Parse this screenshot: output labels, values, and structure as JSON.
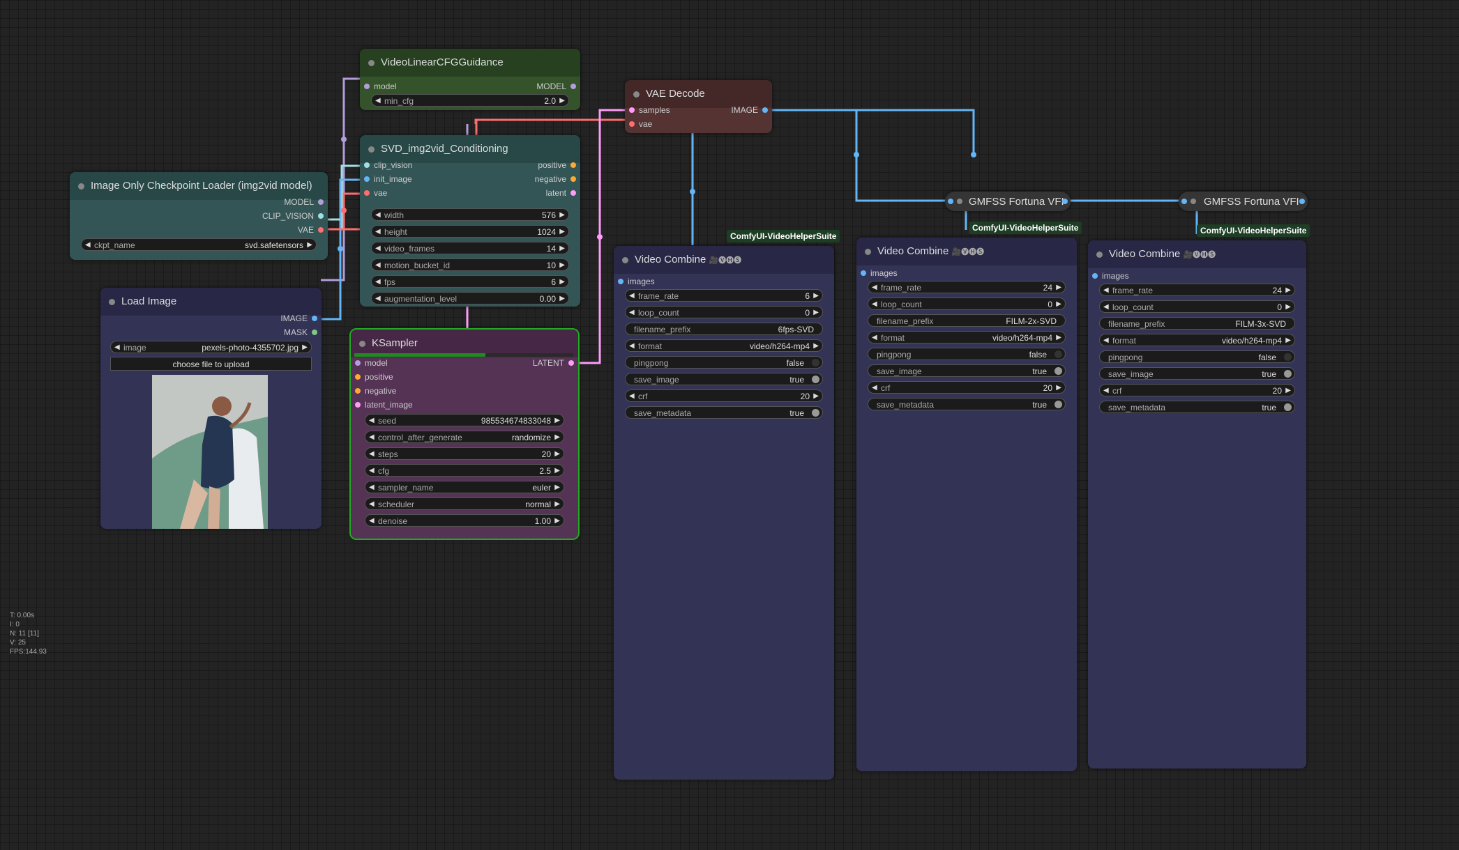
{
  "colors": {
    "canvas": "#232323",
    "clip_vision": "#a1dfe1",
    "image": "#64b5f6",
    "vae": "#ff6e6e",
    "model": "#b39ddb",
    "conditioning": "#ffa931",
    "latent": "#ff9cf9",
    "mask": "#81c784"
  },
  "nodes": {
    "vlcfg": {
      "title": "VideoLinearCFGGuidance",
      "in_model": "model",
      "out_model": "MODEL",
      "min_cfg_label": "min_cfg",
      "min_cfg_value": "2.0"
    },
    "vaedecode": {
      "title": "VAE Decode",
      "in_samples": "samples",
      "in_vae": "vae",
      "out_image": "IMAGE"
    },
    "svd": {
      "title": "SVD_img2vid_Conditioning",
      "in_clip_vision": "clip_vision",
      "in_init_image": "init_image",
      "in_vae": "vae",
      "out_positive": "positive",
      "out_negative": "negative",
      "out_latent": "latent",
      "widgets": [
        {
          "label": "width",
          "value": "576"
        },
        {
          "label": "height",
          "value": "1024"
        },
        {
          "label": "video_frames",
          "value": "14"
        },
        {
          "label": "motion_bucket_id",
          "value": "10"
        },
        {
          "label": "fps",
          "value": "6"
        },
        {
          "label": "augmentation_level",
          "value": "0.00"
        }
      ]
    },
    "ckpt": {
      "title": "Image Only Checkpoint Loader (img2vid model)",
      "out_model": "MODEL",
      "out_clip_vision": "CLIP_VISION",
      "out_vae": "VAE",
      "ckpt_label": "ckpt_name",
      "ckpt_value": "svd.safetensors"
    },
    "loadimage": {
      "title": "Load Image",
      "out_image": "IMAGE",
      "out_mask": "MASK",
      "image_label": "image",
      "image_value": "pexels-photo-4355702.jpg",
      "upload_label": "choose file to upload"
    },
    "ksampler": {
      "title": "KSampler",
      "in_model": "model",
      "in_positive": "positive",
      "in_negative": "negative",
      "in_latent": "latent_image",
      "out_latent": "LATENT",
      "progress": 0.6,
      "widgets": [
        {
          "label": "seed",
          "value": "985534674833048"
        },
        {
          "label": "control_after_generate",
          "value": "randomize"
        },
        {
          "label": "steps",
          "value": "20"
        },
        {
          "label": "cfg",
          "value": "2.5"
        },
        {
          "label": "sampler_name",
          "value": "euler"
        },
        {
          "label": "scheduler",
          "value": "normal"
        },
        {
          "label": "denoise",
          "value": "1.00"
        }
      ]
    },
    "vc1": {
      "title": "Video Combine",
      "badge": "ComfyUI-VideoHelperSuite",
      "icons": "🎥🅥🅗🅢",
      "in_images": "images",
      "frame_rate": "6",
      "loop_count": "0",
      "filename_prefix": "6fps-SVD",
      "format": "video/h264-mp4",
      "pingpong": "false",
      "save_image": "true",
      "crf": "20",
      "save_metadata": "true"
    },
    "vc2": {
      "title": "Video Combine",
      "badge": "ComfyUI-VideoHelperSuite",
      "icons": "🎥🅥🅗🅢",
      "in_images": "images",
      "frame_rate": "24",
      "loop_count": "0",
      "filename_prefix": "FILM-2x-SVD",
      "format": "video/h264-mp4",
      "pingpong": "false",
      "save_image": "true",
      "crf": "20",
      "save_metadata": "true"
    },
    "vc3": {
      "title": "Video Combine",
      "badge": "ComfyUI-VideoHelperSuite",
      "icons": "🎥🅥🅗🅢",
      "in_images": "images",
      "frame_rate": "24",
      "loop_count": "0",
      "filename_prefix": "FILM-3x-SVD",
      "format": "video/h264-mp4",
      "pingpong": "false",
      "save_image": "true",
      "crf": "20",
      "save_metadata": "true"
    },
    "gmfss1": {
      "title": "GMFSS Fortuna VFI"
    },
    "gmfss2": {
      "title": "GMFSS Fortuna VFI"
    }
  },
  "labels": {
    "frame_rate": "frame_rate",
    "loop_count": "loop_count",
    "filename_prefix": "filename_prefix",
    "format": "format",
    "pingpong": "pingpong",
    "save_image": "save_image",
    "crf": "crf",
    "save_metadata": "save_metadata"
  },
  "stats": {
    "t": "T: 0.00s",
    "i": "I: 0",
    "n": "N: 11 [11]",
    "v": "V: 25",
    "fps": "FPS:144.93"
  }
}
